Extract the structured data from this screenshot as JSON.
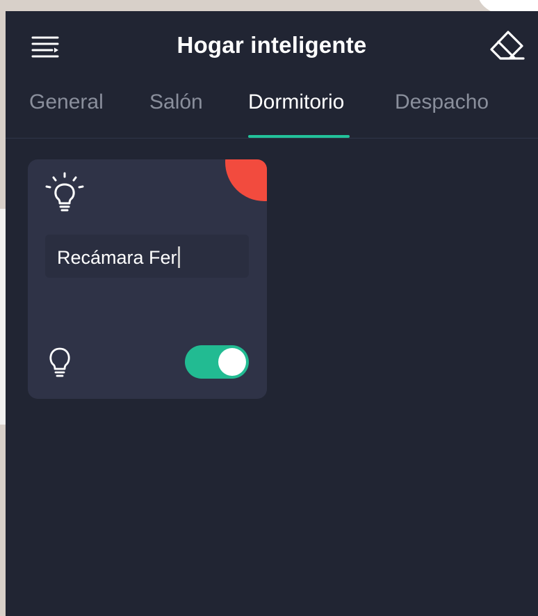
{
  "app": {
    "title": "Hogar inteligente"
  },
  "tabs": [
    {
      "label": "General",
      "active": false
    },
    {
      "label": "Salón",
      "active": false
    },
    {
      "label": "Dormitorio",
      "active": true
    },
    {
      "label": "Despacho",
      "active": false
    }
  ],
  "card": {
    "name_value": "Recámara Fer",
    "switch_on": true,
    "icons": {
      "top": "lightbulb-on-icon",
      "bottom": "lightbulb-icon",
      "delete": "close-icon"
    }
  },
  "toolbar": {
    "menu_icon": "menu-icon",
    "edit_icon": "eraser-icon"
  },
  "colors": {
    "background": "#212533",
    "card": "#2f3347",
    "accent": "#22bb92",
    "delete": "#f24b3e",
    "tab_inactive": "#8a8f9c",
    "text": "#ffffff"
  }
}
